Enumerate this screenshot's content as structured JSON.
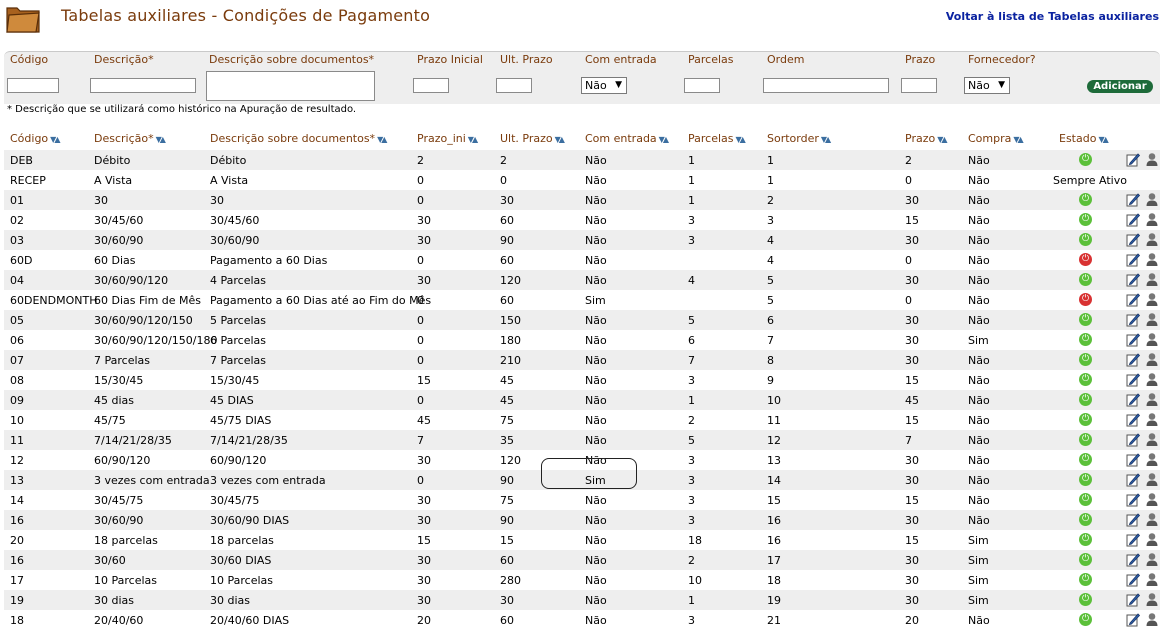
{
  "title": "Tabelas auxiliares - Condições de Pagamento",
  "back_link": "Voltar à lista de Tabelas auxiliares",
  "form": {
    "labels": {
      "codigo": "Código",
      "descricao": "Descrição*",
      "descricao_docs": "Descrição sobre documentos*",
      "prazo_inicial": "Prazo Inicial",
      "ult_prazo": "Ult. Prazo",
      "com_entrada": "Com entrada",
      "parcelas": "Parcelas",
      "ordem": "Ordem",
      "prazo": "Prazo",
      "fornecedor": "Fornecedor?"
    },
    "com_entrada_value": "Não",
    "fornecedor_value": "Não",
    "add_label": "Adicionar"
  },
  "note": "* Descrição que se utilizará como histórico na Apuração de resultado.",
  "table": {
    "headers": {
      "codigo": "Código",
      "descricao": "Descrição*",
      "descricao_docs": "Descrição sobre documentos*",
      "prazo_ini": "Prazo_ini",
      "ult_prazo": "Ult. Prazo",
      "com_entrada": "Com entrada",
      "parcelas": "Parcelas",
      "sortorder": "Sortorder",
      "prazo": "Prazo",
      "compra": "Compra",
      "estado": "Estado"
    },
    "always_active": "Sempre Ativo",
    "status_colors": {
      "active": "#5cc03a",
      "inactive": "#d83232"
    },
    "rows": [
      {
        "codigo": "DEB",
        "descricao": "Débito",
        "docs": "Débito",
        "prazo_ini": "2",
        "ult": "2",
        "entrada": "Não",
        "parcelas": "1",
        "sort": "1",
        "prazo": "2",
        "compra": "Não",
        "estado": "active"
      },
      {
        "codigo": "RECEP",
        "descricao": "A Vista",
        "docs": "A Vista",
        "prazo_ini": "0",
        "ult": "0",
        "entrada": "Não",
        "parcelas": "1",
        "sort": "1",
        "prazo": "0",
        "compra": "Não",
        "estado": "always"
      },
      {
        "codigo": "01",
        "descricao": "30",
        "docs": "30",
        "prazo_ini": "0",
        "ult": "30",
        "entrada": "Não",
        "parcelas": "1",
        "sort": "2",
        "prazo": "30",
        "compra": "Não",
        "estado": "active"
      },
      {
        "codigo": "02",
        "descricao": "30/45/60",
        "docs": "30/45/60",
        "prazo_ini": "30",
        "ult": "60",
        "entrada": "Não",
        "parcelas": "3",
        "sort": "3",
        "prazo": "15",
        "compra": "Não",
        "estado": "active"
      },
      {
        "codigo": "03",
        "descricao": "30/60/90",
        "docs": "30/60/90",
        "prazo_ini": "30",
        "ult": "90",
        "entrada": "Não",
        "parcelas": "3",
        "sort": "4",
        "prazo": "30",
        "compra": "Não",
        "estado": "active"
      },
      {
        "codigo": "60D",
        "descricao": "60 Dias",
        "docs": "Pagamento a 60 Dias",
        "prazo_ini": "0",
        "ult": "60",
        "entrada": "Não",
        "parcelas": "",
        "sort": "4",
        "prazo": "0",
        "compra": "Não",
        "estado": "inactive"
      },
      {
        "codigo": "04",
        "descricao": "30/60/90/120",
        "docs": "4 Parcelas",
        "prazo_ini": "30",
        "ult": "120",
        "entrada": "Não",
        "parcelas": "4",
        "sort": "5",
        "prazo": "30",
        "compra": "Não",
        "estado": "active"
      },
      {
        "codigo": "60DENDMONTH",
        "descricao": "60 Dias Fim de Mês",
        "docs": "Pagamento a 60 Dias até ao Fim do Mês",
        "prazo_ini": "0",
        "ult": "60",
        "entrada": "Sim",
        "parcelas": "",
        "sort": "5",
        "prazo": "0",
        "compra": "Não",
        "estado": "inactive"
      },
      {
        "codigo": "05",
        "descricao": "30/60/90/120/150",
        "docs": "5 Parcelas",
        "prazo_ini": "0",
        "ult": "150",
        "entrada": "Não",
        "parcelas": "5",
        "sort": "6",
        "prazo": "30",
        "compra": "Não",
        "estado": "active"
      },
      {
        "codigo": "06",
        "descricao": "30/60/90/120/150/180",
        "docs": "6 Parcelas",
        "prazo_ini": "0",
        "ult": "180",
        "entrada": "Não",
        "parcelas": "6",
        "sort": "7",
        "prazo": "30",
        "compra": "Sim",
        "estado": "active"
      },
      {
        "codigo": "07",
        "descricao": "7 Parcelas",
        "docs": "7 Parcelas",
        "prazo_ini": "0",
        "ult": "210",
        "entrada": "Não",
        "parcelas": "7",
        "sort": "8",
        "prazo": "30",
        "compra": "Não",
        "estado": "active"
      },
      {
        "codigo": "08",
        "descricao": "15/30/45",
        "docs": "15/30/45",
        "prazo_ini": "15",
        "ult": "45",
        "entrada": "Não",
        "parcelas": "3",
        "sort": "9",
        "prazo": "15",
        "compra": "Não",
        "estado": "active"
      },
      {
        "codigo": "09",
        "descricao": "45 dias",
        "docs": "45 DIAS",
        "prazo_ini": "0",
        "ult": "45",
        "entrada": "Não",
        "parcelas": "1",
        "sort": "10",
        "prazo": "45",
        "compra": "Não",
        "estado": "active"
      },
      {
        "codigo": "10",
        "descricao": "45/75",
        "docs": "45/75 DIAS",
        "prazo_ini": "45",
        "ult": "75",
        "entrada": "Não",
        "parcelas": "2",
        "sort": "11",
        "prazo": "15",
        "compra": "Não",
        "estado": "active"
      },
      {
        "codigo": "11",
        "descricao": "7/14/21/28/35",
        "docs": "7/14/21/28/35",
        "prazo_ini": "7",
        "ult": "35",
        "entrada": "Não",
        "parcelas": "5",
        "sort": "12",
        "prazo": "7",
        "compra": "Não",
        "estado": "active"
      },
      {
        "codigo": "12",
        "descricao": "60/90/120",
        "docs": "60/90/120",
        "prazo_ini": "30",
        "ult": "120",
        "entrada": "Não",
        "parcelas": "3",
        "sort": "13",
        "prazo": "30",
        "compra": "Não",
        "estado": "active"
      },
      {
        "codigo": "13",
        "descricao": "3 vezes com entrada",
        "docs": "3 vezes com entrada",
        "prazo_ini": "0",
        "ult": "90",
        "entrada": "Sim",
        "parcelas": "3",
        "sort": "14",
        "prazo": "30",
        "compra": "Não",
        "estado": "active"
      },
      {
        "codigo": "14",
        "descricao": "30/45/75",
        "docs": "30/45/75",
        "prazo_ini": "30",
        "ult": "75",
        "entrada": "Não",
        "parcelas": "3",
        "sort": "15",
        "prazo": "15",
        "compra": "Não",
        "estado": "active"
      },
      {
        "codigo": "16",
        "descricao": "30/60/90",
        "docs": "30/60/90 DIAS",
        "prazo_ini": "30",
        "ult": "90",
        "entrada": "Não",
        "parcelas": "3",
        "sort": "16",
        "prazo": "30",
        "compra": "Não",
        "estado": "active"
      },
      {
        "codigo": "20",
        "descricao": "18 parcelas",
        "docs": "18 parcelas",
        "prazo_ini": "15",
        "ult": "15",
        "entrada": "Não",
        "parcelas": "18",
        "sort": "16",
        "prazo": "15",
        "compra": "Sim",
        "estado": "active"
      },
      {
        "codigo": "16",
        "descricao": "30/60",
        "docs": "30/60 DIAS",
        "prazo_ini": "30",
        "ult": "60",
        "entrada": "Não",
        "parcelas": "2",
        "sort": "17",
        "prazo": "30",
        "compra": "Sim",
        "estado": "active"
      },
      {
        "codigo": "17",
        "descricao": "10 Parcelas",
        "docs": "10 Parcelas",
        "prazo_ini": "30",
        "ult": "280",
        "entrada": "Não",
        "parcelas": "10",
        "sort": "18",
        "prazo": "30",
        "compra": "Sim",
        "estado": "active"
      },
      {
        "codigo": "19",
        "descricao": "30 dias",
        "docs": "30 dias",
        "prazo_ini": "30",
        "ult": "30",
        "entrada": "Não",
        "parcelas": "1",
        "sort": "19",
        "prazo": "30",
        "compra": "Sim",
        "estado": "active"
      },
      {
        "codigo": "18",
        "descricao": "20/40/60",
        "docs": "20/40/60 DIAS",
        "prazo_ini": "20",
        "ult": "60",
        "entrada": "Não",
        "parcelas": "3",
        "sort": "21",
        "prazo": "20",
        "compra": "Não",
        "estado": "active"
      }
    ]
  }
}
